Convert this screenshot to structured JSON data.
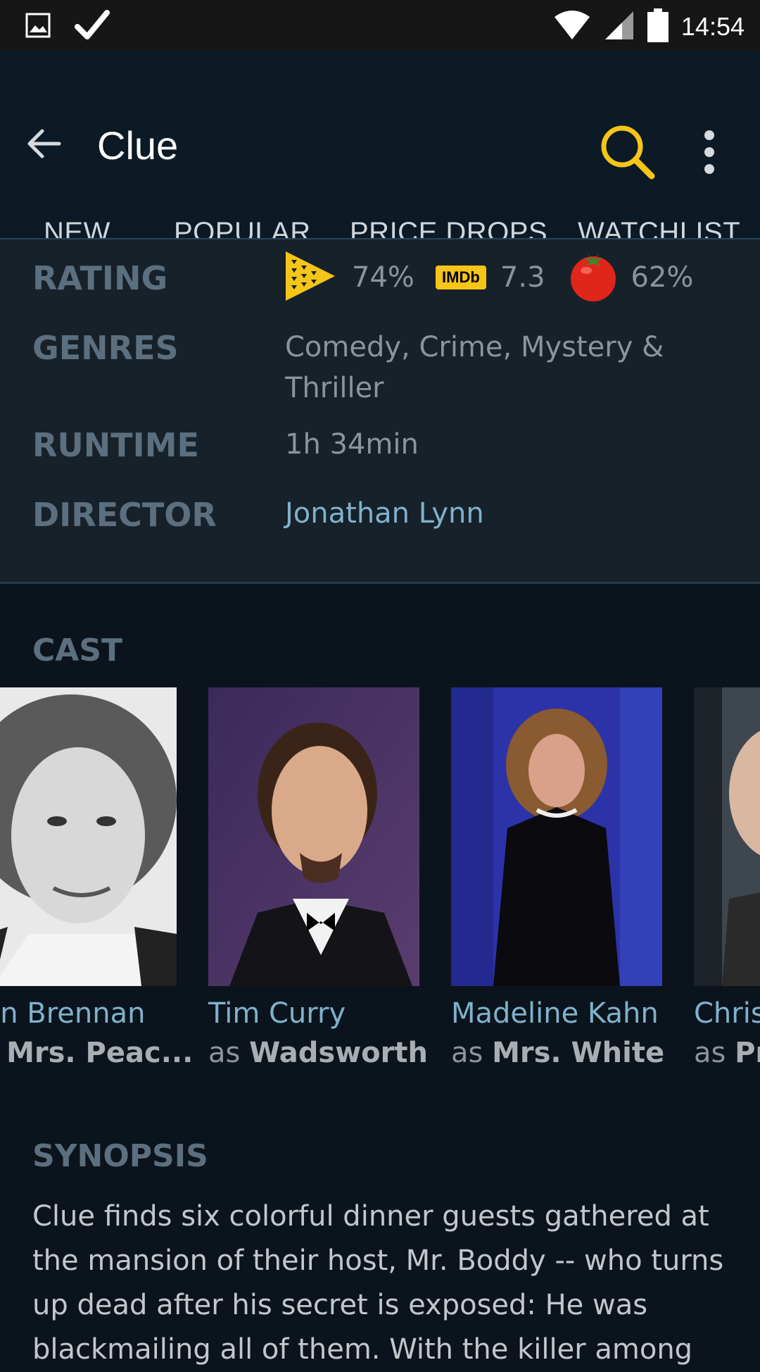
{
  "status_bar": {
    "time": "14:54",
    "icons": [
      "image-icon",
      "check-icon",
      "wifi-icon",
      "signal-icon",
      "battery-icon"
    ]
  },
  "app_bar": {
    "title": "Clue",
    "icons": [
      "back-arrow-icon",
      "search-icon",
      "more-vert-icon"
    ],
    "accent_color": "#f5c518"
  },
  "tabs": [
    {
      "label": "NEW"
    },
    {
      "label": "POPULAR"
    },
    {
      "label": "PRICE DROPS"
    },
    {
      "label": "WATCHLIST"
    }
  ],
  "details": {
    "rating_label": "RATING",
    "ratings": [
      {
        "source": "justwatch-icon",
        "value": "74%"
      },
      {
        "source": "IMDb",
        "value": "7.3"
      },
      {
        "source": "tomato-icon",
        "value": "62%"
      }
    ],
    "genres_label": "GENRES",
    "genres_line1": "Comedy, Crime, Mystery &",
    "genres_line2": "Thriller",
    "runtime_label": "RUNTIME",
    "runtime": "1h 34min",
    "director_label": "DIRECTOR",
    "director": "Jonathan Lynn"
  },
  "cast": {
    "title": "CAST",
    "members": [
      {
        "name": "een Brennan",
        "as": "as",
        "role": "Mrs. Peac..."
      },
      {
        "name": "Tim Curry",
        "as": "as",
        "role": "Wadsworth"
      },
      {
        "name": "Madeline Kahn",
        "as": "as",
        "role": "Mrs. White"
      },
      {
        "name": "Chris",
        "as": "as",
        "role": "Pr"
      }
    ]
  },
  "synopsis": {
    "title": "SYNOPSIS",
    "text": "Clue finds six colorful dinner guests gathered at the mansion of their host, Mr. Boddy -- who turns up dead after his secret is exposed: He was blackmailing all of them. With the killer among"
  }
}
